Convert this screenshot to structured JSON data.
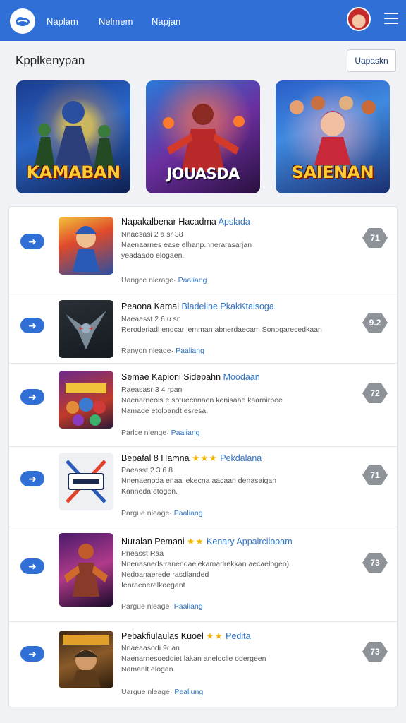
{
  "header": {
    "nav": [
      "Naplam",
      "Nelmem",
      "Napjan"
    ],
    "logo_icon": "cloud-logo",
    "menu_icon": "hamburger-menu"
  },
  "page": {
    "title": "Kpplkenypan",
    "action_label": "Uapaskn"
  },
  "banners": [
    {
      "title": "KAMABAN"
    },
    {
      "title": "JOUASDA"
    },
    {
      "title": "SAIENAN"
    }
  ],
  "items": [
    {
      "title": "Napakalbenar Hacadma",
      "category": "Apslada",
      "stars": "",
      "meta": [
        "Nnaesasi 2 a sr 38",
        "Naenaarnes ease elhanp.nnerarasarjan",
        "yeadaado elogaen."
      ],
      "foot_left": "Uangce nlerage·",
      "foot_link": "Paaliang",
      "rating": "71"
    },
    {
      "title": "Peaona Kamal",
      "category": "Bladeline PkakKtalsoga",
      "stars": "",
      "meta": [
        "Naeaasst 2 6 u sn",
        "Reroderiadl endcar lemman abnerdaecam Sonpgarecedkaan"
      ],
      "foot_left": "Ranyon nleage·",
      "foot_link": "Paaliang",
      "rating": "9.2"
    },
    {
      "title": "Semae Kapioni Sidepahn",
      "category": "Moodaan",
      "stars": "",
      "meta": [
        "Raeasasr 3 4 rpan",
        "Naenarneols e sotuecnnaen kenisaae kaarnirpee",
        "Namade etoloandt esresa."
      ],
      "foot_left": "Parlce nlenge·",
      "foot_link": "Paaliang",
      "rating": "72"
    },
    {
      "title": "Bepafal 8 Hamna",
      "category": "Pekdalana",
      "stars": "★★★",
      "meta": [
        "Paeasst 2 3 6 8",
        "Nnenaenoda enaai ekecna aacaan denasaigan",
        "Kanneda etogen."
      ],
      "foot_left": "Pargue nleage·",
      "foot_link": "Paaliang",
      "rating": "71"
    },
    {
      "title": "Nuralan Pemani",
      "category": "Kenary Appalrcilooam",
      "stars": "★★",
      "meta": [
        "Pneasst Raa",
        "Nnenasneds ranendaelekamarlrekkan aecaelbgeo)",
        "Nedoanaerede rasdlanded",
        "Ienraenerelkoegant"
      ],
      "foot_left": "Pargue nleage·",
      "foot_link": "Paaliang",
      "rating": "73"
    },
    {
      "title": "Pebakfiulaulas Kuoel",
      "category": "Pedita",
      "stars": "★★",
      "meta": [
        "Nnaeaasodi 9r an",
        "Naenarnesoeddiet lakan aneloclie odergeen",
        "Namanlt elogan."
      ],
      "foot_left": "Uargue nleage·",
      "foot_link": "Pealiung",
      "rating": "73"
    }
  ]
}
